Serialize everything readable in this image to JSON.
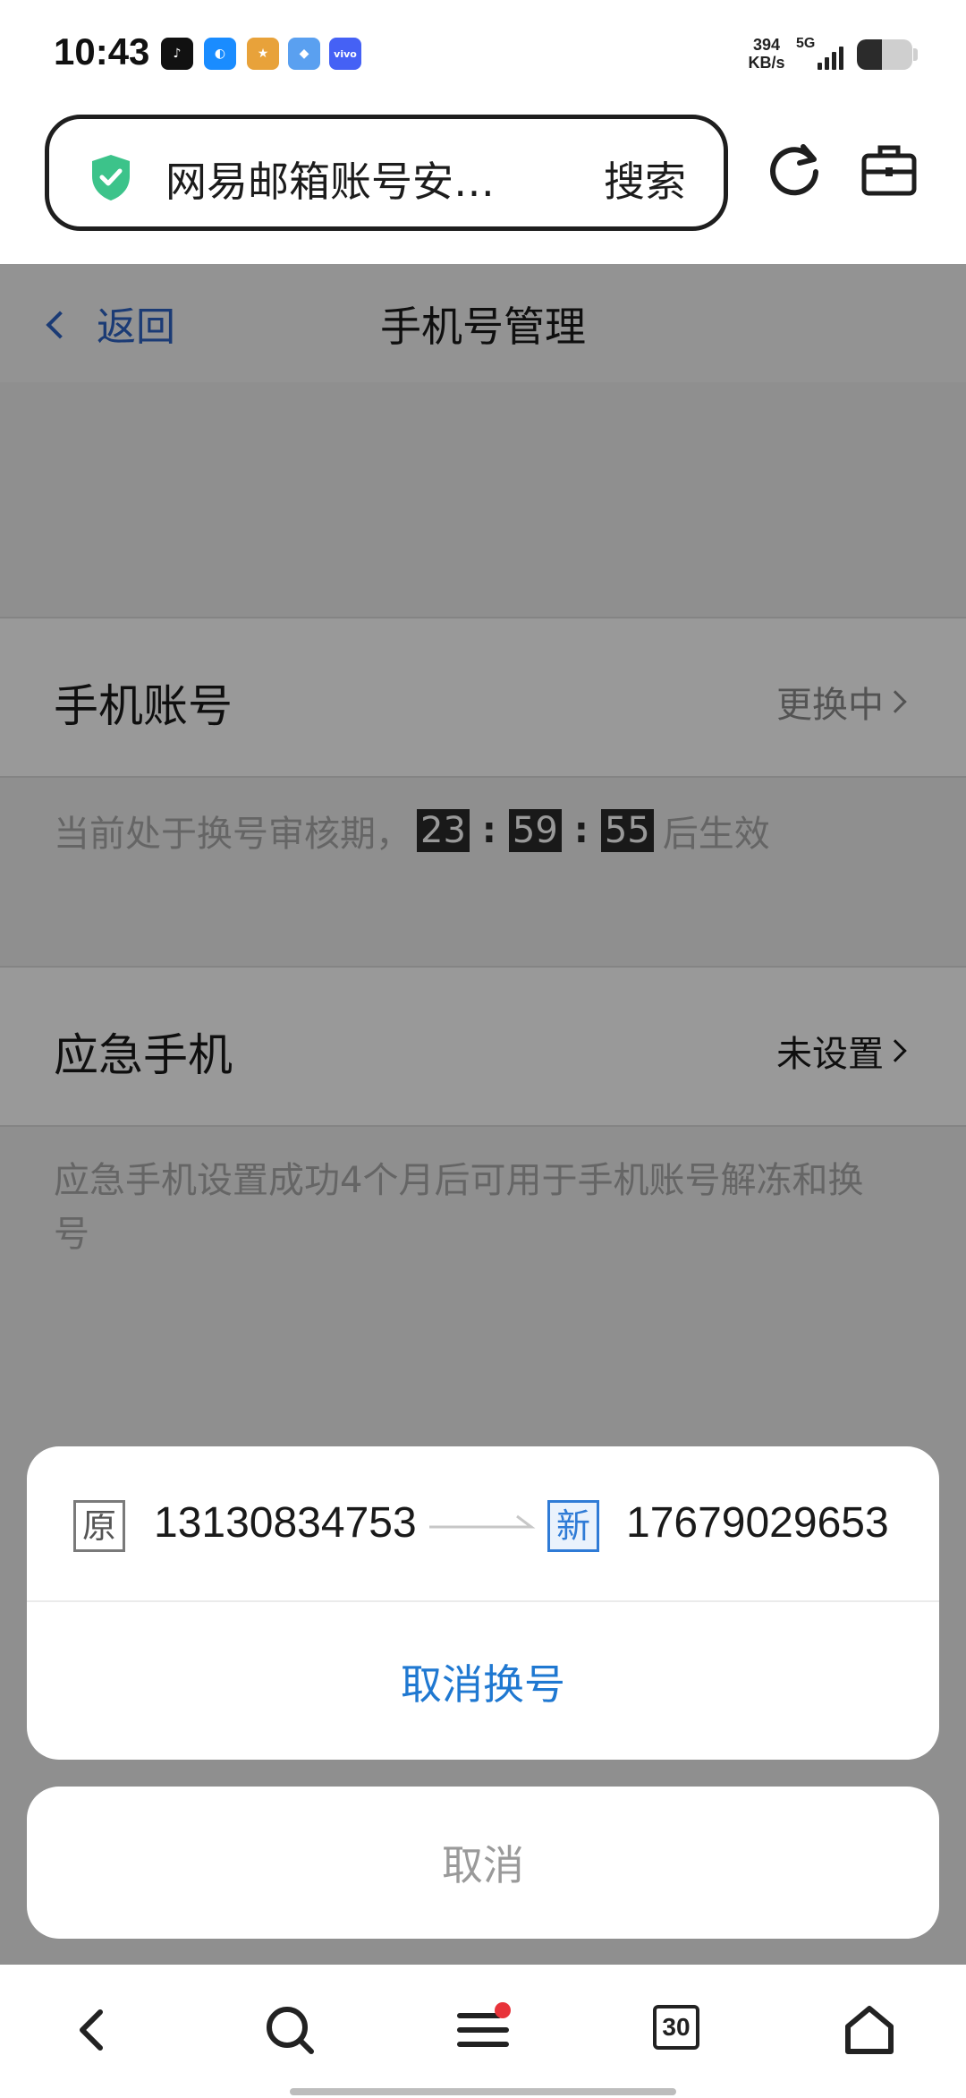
{
  "status_bar": {
    "time": "10:43",
    "speed_value": "394",
    "speed_unit": "KB/s",
    "network": "5G",
    "battery_level": 0.45,
    "apps": [
      "tiktok-icon",
      "browser-icon",
      "game-icon",
      "wallet-icon",
      "vivo-icon"
    ],
    "vivo_label": "vivo"
  },
  "browser": {
    "url_text": "网易邮箱账号安…",
    "search_label": "搜索",
    "shield_color": "#3cc38a"
  },
  "nav": {
    "back_label": "返回",
    "title": "手机号管理"
  },
  "phone_account": {
    "label": "手机账号",
    "status": "更换中"
  },
  "review": {
    "prefix": "当前处于换号审核期，",
    "hours": "23",
    "minutes": "59",
    "seconds": "55",
    "separator": ":",
    "suffix": "后生效"
  },
  "emergency": {
    "label": "应急手机",
    "status": "未设置",
    "hint_line1": "应急手机设置成功4个月后可用于手机账号解冻和换",
    "hint_line2": "号"
  },
  "sheet": {
    "old_tag": "原",
    "old_number": "13130834753",
    "new_tag": "新",
    "new_number": "17679029653",
    "action_label": "取消换号",
    "cancel_label": "取消"
  },
  "bottom_nav": {
    "tabs_count": "30",
    "items": [
      "back-icon",
      "search-icon",
      "menu-icon",
      "tabs-icon",
      "home-icon"
    ]
  },
  "colors": {
    "accent_blue": "#1f78d1",
    "link_blue": "#2d63c4",
    "notification_red": "#e8333a"
  }
}
